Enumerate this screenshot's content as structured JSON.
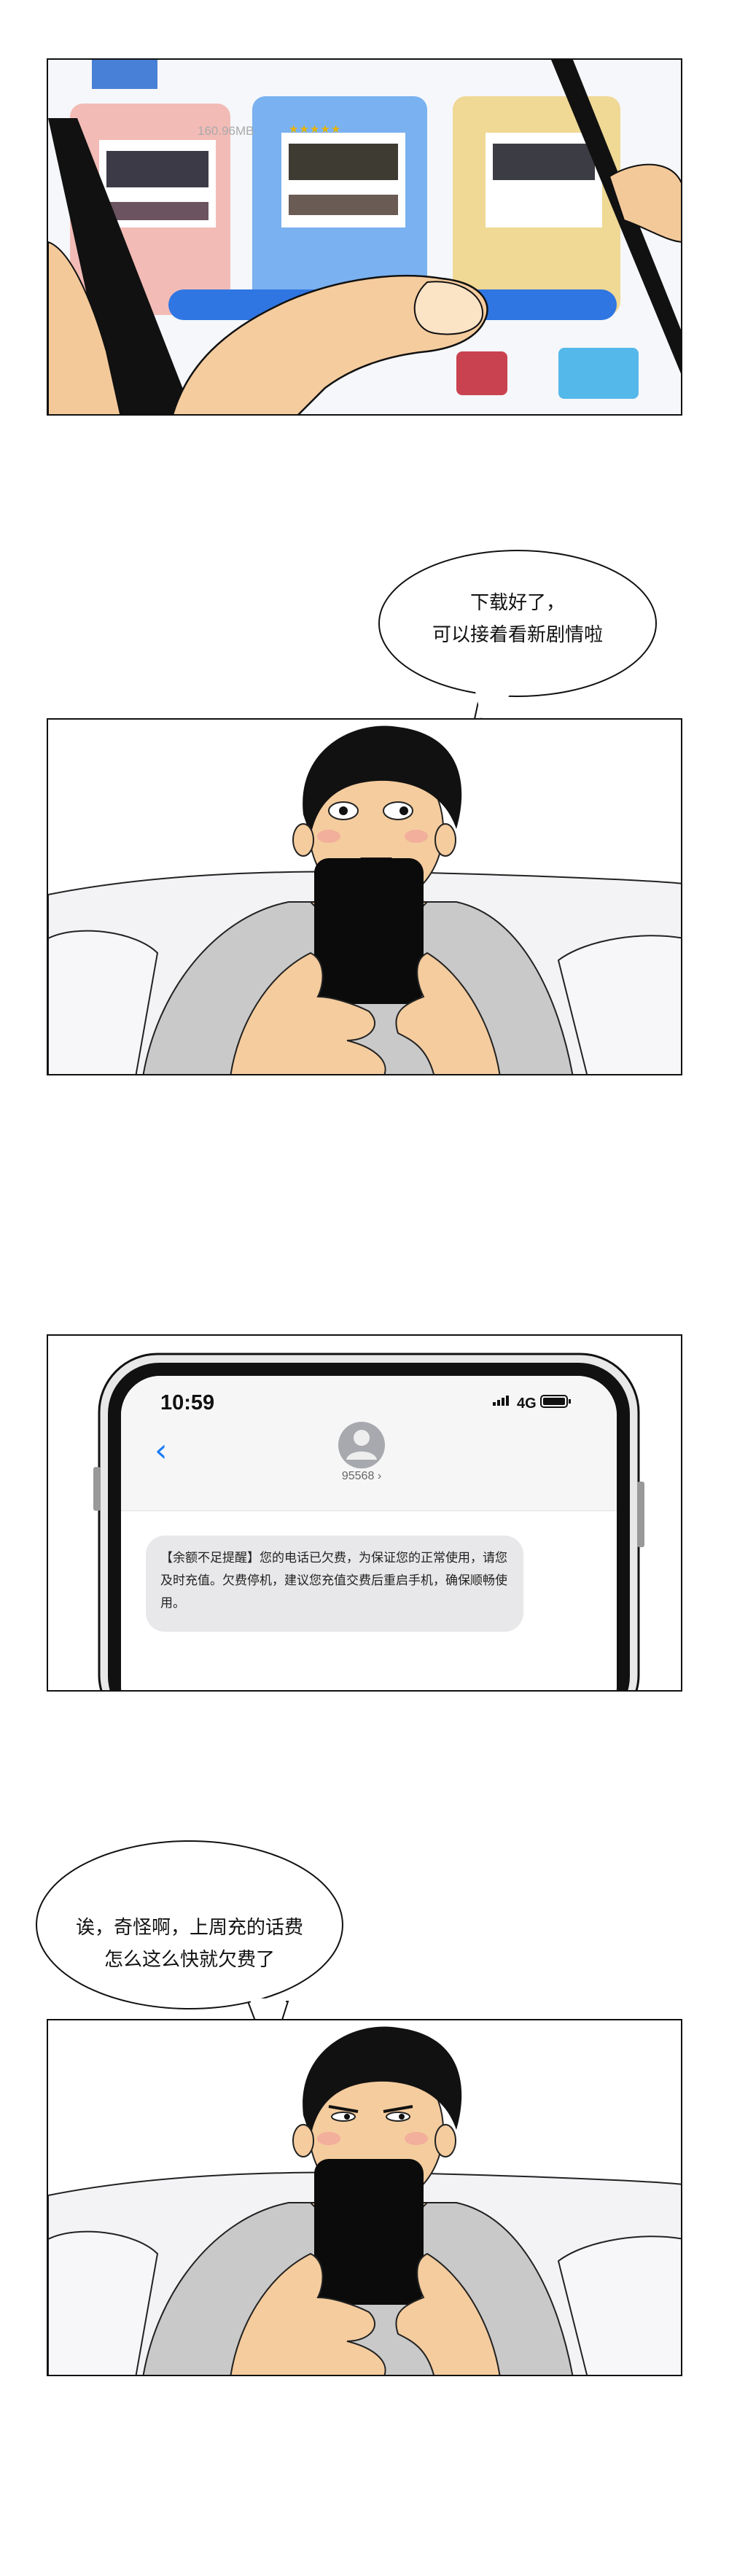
{
  "panel1": {
    "app_size": "160.96MB",
    "stars": "★★★★★"
  },
  "bubble1": {
    "line1": "下载好了，",
    "line2": "可以接着看新剧情啦"
  },
  "phone": {
    "time": "10:59",
    "network": "4G",
    "back_icon": "chevron-left-icon",
    "sender": "95568",
    "sender_suffix": "›",
    "message": "【余额不足提醒】您的电话已欠费，为保证您的正常使用，请您及时充值。欠费停机，建议您充值交费后重启手机，确保顺畅使用。"
  },
  "bubble2": {
    "line1": "诶，奇怪啊，上周充的话费",
    "line2": "怎么这么快就欠费了"
  },
  "colors": {
    "ios_blue": "#1a7cf5",
    "skin": "#f7d2a4",
    "sheet": "#f2f2f4"
  }
}
